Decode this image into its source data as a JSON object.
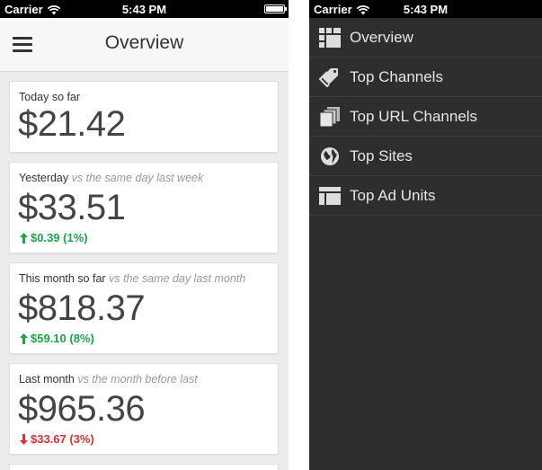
{
  "status_bar": {
    "carrier": "Carrier",
    "time": "5:43 PM"
  },
  "overview": {
    "title": "Overview",
    "cards": [
      {
        "label": "Today so far",
        "comparison": "",
        "amount": "$21.42",
        "delta": "",
        "direction": ""
      },
      {
        "label": "Yesterday",
        "comparison": "vs the same day last week",
        "amount": "$33.51",
        "delta": "$0.39 (1%)",
        "direction": "up"
      },
      {
        "label": "This month so far",
        "comparison": "vs the same day last month",
        "amount": "$818.37",
        "delta": "$59.10 (8%)",
        "direction": "up"
      },
      {
        "label": "Last month",
        "comparison": "vs the month before last",
        "amount": "$965.36",
        "delta": "$33.67 (3%)",
        "direction": "down"
      }
    ]
  },
  "menu": {
    "items": [
      {
        "label": "Overview",
        "icon": "grid-icon"
      },
      {
        "label": "Top Channels",
        "icon": "tags-icon"
      },
      {
        "label": "Top URL Channels",
        "icon": "pages-icon"
      },
      {
        "label": "Top Sites",
        "icon": "globe-icon"
      },
      {
        "label": "Top Ad Units",
        "icon": "layout-icon"
      }
    ]
  },
  "colors": {
    "positive": "#1fa34a",
    "negative": "#e02e2e",
    "menu_background": "#2e2e2e",
    "card_background": "#ffffff"
  }
}
